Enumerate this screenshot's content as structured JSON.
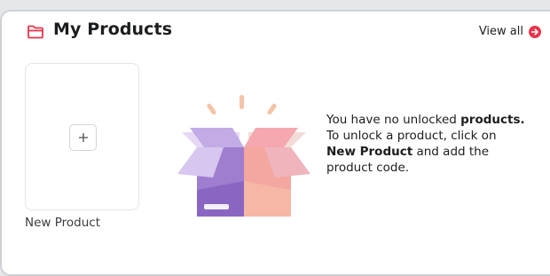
{
  "header": {
    "title": "My Products",
    "view_all_label": "View all",
    "title_icon": "folder-icon",
    "view_all_icon": "arrow-right-circle-icon"
  },
  "new_product_tile": {
    "label": "New Product",
    "icon": "plus-icon"
  },
  "empty_state": {
    "illustration": "open-box-icon",
    "line1_prefix": "You have no unlocked ",
    "line1_bold": "products.",
    "line2": "To unlock a product, click on",
    "line3_bold": "New Product",
    "line3_suffix": " and add the",
    "line4": "product code."
  },
  "colors": {
    "accent": "#e8344a",
    "text": "#1c1d1f",
    "page_background": "#e5e7e9"
  }
}
